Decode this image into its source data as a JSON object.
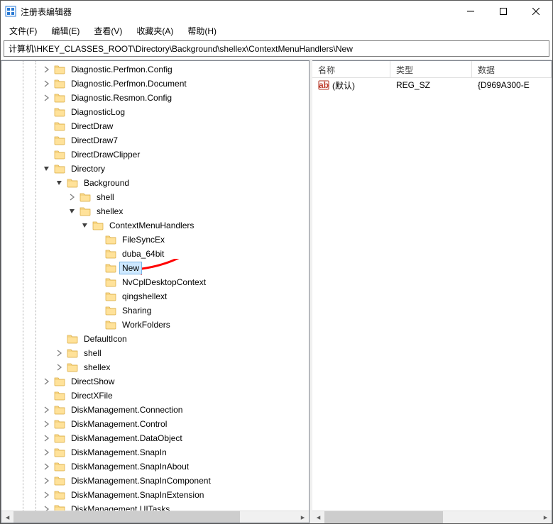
{
  "title": "注册表编辑器",
  "menu": {
    "file": "文件(F)",
    "edit": "编辑(E)",
    "view": "查看(V)",
    "fav": "收藏夹(A)",
    "help": "帮助(H)"
  },
  "address": "计算机\\HKEY_CLASSES_ROOT\\Directory\\Background\\shellex\\ContextMenuHandlers\\New",
  "tree": [
    {
      "d": 2,
      "e": 1,
      "l": "Diagnostic.Perfmon.Config"
    },
    {
      "d": 2,
      "e": 1,
      "l": "Diagnostic.Perfmon.Document"
    },
    {
      "d": 2,
      "e": 1,
      "l": "Diagnostic.Resmon.Config"
    },
    {
      "d": 2,
      "e": 0,
      "l": "DiagnosticLog"
    },
    {
      "d": 2,
      "e": 0,
      "l": "DirectDraw"
    },
    {
      "d": 2,
      "e": 0,
      "l": "DirectDraw7"
    },
    {
      "d": 2,
      "e": 0,
      "l": "DirectDrawClipper"
    },
    {
      "d": 2,
      "e": 2,
      "l": "Directory"
    },
    {
      "d": 3,
      "e": 2,
      "l": "Background"
    },
    {
      "d": 4,
      "e": 1,
      "l": "shell"
    },
    {
      "d": 4,
      "e": 2,
      "l": "shellex"
    },
    {
      "d": 5,
      "e": 2,
      "l": "ContextMenuHandlers"
    },
    {
      "d": 6,
      "e": 0,
      "l": " FileSyncEx"
    },
    {
      "d": 6,
      "e": 0,
      "l": "duba_64bit"
    },
    {
      "d": 6,
      "e": 0,
      "l": "New",
      "sel": true
    },
    {
      "d": 6,
      "e": 0,
      "l": "NvCplDesktopContext"
    },
    {
      "d": 6,
      "e": 0,
      "l": "qingshellext"
    },
    {
      "d": 6,
      "e": 0,
      "l": "Sharing"
    },
    {
      "d": 6,
      "e": 0,
      "l": "WorkFolders"
    },
    {
      "d": 3,
      "e": 0,
      "l": "DefaultIcon"
    },
    {
      "d": 3,
      "e": 1,
      "l": "shell"
    },
    {
      "d": 3,
      "e": 1,
      "l": "shellex"
    },
    {
      "d": 2,
      "e": 1,
      "l": "DirectShow"
    },
    {
      "d": 2,
      "e": 0,
      "l": "DirectXFile"
    },
    {
      "d": 2,
      "e": 1,
      "l": "DiskManagement.Connection"
    },
    {
      "d": 2,
      "e": 1,
      "l": "DiskManagement.Control"
    },
    {
      "d": 2,
      "e": 1,
      "l": "DiskManagement.DataObject"
    },
    {
      "d": 2,
      "e": 1,
      "l": "DiskManagement.SnapIn"
    },
    {
      "d": 2,
      "e": 1,
      "l": "DiskManagement.SnapInAbout"
    },
    {
      "d": 2,
      "e": 1,
      "l": "DiskManagement.SnapInComponent"
    },
    {
      "d": 2,
      "e": 1,
      "l": "DiskManagement.SnapInExtension"
    },
    {
      "d": 2,
      "e": 1,
      "l": "DiskManagement.UITasks"
    }
  ],
  "cols": {
    "name": "名称",
    "type": "类型",
    "data": "数据"
  },
  "row": {
    "name": "(默认)",
    "type": "REG_SZ",
    "data": "{D969A300-E"
  }
}
